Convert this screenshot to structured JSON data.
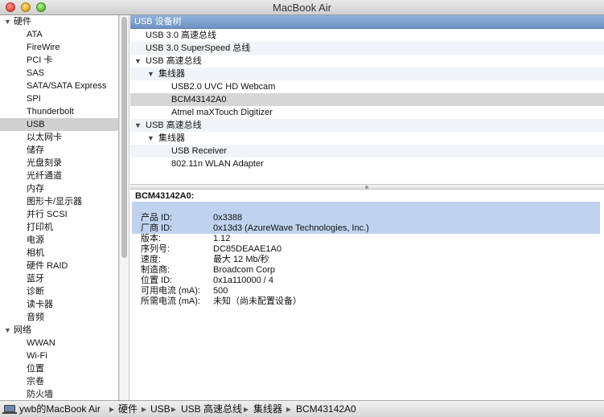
{
  "window": {
    "title": "MacBook Air"
  },
  "sidebar": {
    "sections": [
      {
        "label": "硬件",
        "expanded": true,
        "items": [
          "ATA",
          "FireWire",
          "PCI 卡",
          "SAS",
          "SATA/SATA Express",
          "SPI",
          "Thunderbolt",
          "USB",
          "以太网卡",
          "储存",
          "光盘刻录",
          "光纤通道",
          "内存",
          "图形卡/显示器",
          "并行 SCSI",
          "打印机",
          "电源",
          "相机",
          "硬件 RAID",
          "蓝牙",
          "诊断",
          "读卡器",
          "音频"
        ]
      },
      {
        "label": "网络",
        "expanded": true,
        "items": [
          "WWAN",
          "Wi-Fi",
          "位置",
          "宗卷",
          "防火墙"
        ]
      }
    ],
    "selected": "USB"
  },
  "tree": {
    "header": "USB 设备树",
    "rows": [
      {
        "label": "USB 3.0 高速总线",
        "level": 1,
        "disclosure": ""
      },
      {
        "label": "USB 3.0 SuperSpeed 总线",
        "level": 1,
        "disclosure": ""
      },
      {
        "label": "USB 高速总线",
        "level": 1,
        "disclosure": "▼"
      },
      {
        "label": "集线器",
        "level": 2,
        "disclosure": "▼"
      },
      {
        "label": "USB2.0 UVC HD Webcam",
        "level": 3,
        "disclosure": ""
      },
      {
        "label": "BCM43142A0",
        "level": 3,
        "disclosure": "",
        "selected": true
      },
      {
        "label": "Atmel maXTouch Digitizer",
        "level": 3,
        "disclosure": ""
      },
      {
        "label": "USB 高速总线",
        "level": 1,
        "disclosure": "▼"
      },
      {
        "label": "集线器",
        "level": 2,
        "disclosure": "▼"
      },
      {
        "label": "USB Receiver",
        "level": 3,
        "disclosure": ""
      },
      {
        "label": "802.11n WLAN Adapter",
        "level": 3,
        "disclosure": ""
      }
    ]
  },
  "details": {
    "title": "BCM43142A0:",
    "properties": [
      {
        "key": "产品 ID:",
        "value": "0x3388"
      },
      {
        "key": "厂商 ID:",
        "value": "0x13d3  (AzureWave Technologies, Inc.)"
      },
      {
        "key": "版本:",
        "value": " 1.12"
      },
      {
        "key": "序列号:",
        "value": "DC85DEAAE1A0"
      },
      {
        "key": "速度:",
        "value": "最大 12 Mb/秒"
      },
      {
        "key": "制造商:",
        "value": "Broadcom Corp"
      },
      {
        "key": "位置 ID:",
        "value": "0x1a110000 / 4"
      },
      {
        "key": "可用电流 (mA):",
        "value": "500"
      },
      {
        "key": "所需电流 (mA):",
        "value": "未知（尚未配置设备）"
      }
    ]
  },
  "pathbar": {
    "items": [
      "ywb的MacBook Air",
      "硬件",
      "USB",
      "USB 高速总线",
      "集线器",
      "BCM43142A0"
    ],
    "separator": "▸",
    "icon": "laptop-icon"
  }
}
